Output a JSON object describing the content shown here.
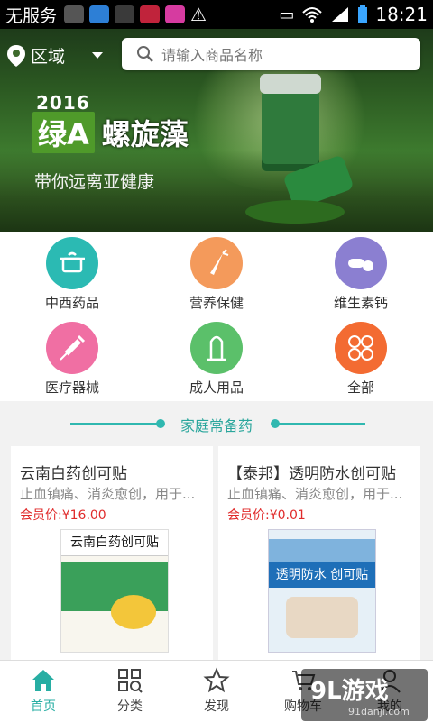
{
  "status_bar": {
    "carrier": "无服务",
    "time": "18:21"
  },
  "header": {
    "region_label": "区域",
    "search_placeholder": "请输入商品名称"
  },
  "banner": {
    "year": "2016",
    "brand_prefix": "绿A",
    "brand_name": "螺旋藻",
    "slogan": "带你远离亚健康"
  },
  "categories": [
    {
      "label": "中西药品",
      "color": "#2bbab3",
      "icon": "pot-icon"
    },
    {
      "label": "营养保健",
      "color": "#f49a5b",
      "icon": "carrot-icon"
    },
    {
      "label": "维生素钙",
      "color": "#8b7fd1",
      "icon": "pills-icon"
    },
    {
      "label": "医疗器械",
      "color": "#f06fa3",
      "icon": "syringe-icon"
    },
    {
      "label": "成人用品",
      "color": "#5bc06a",
      "icon": "condom-icon"
    },
    {
      "label": "全部",
      "color": "#f36b32",
      "icon": "all-circles-icon"
    }
  ],
  "section": {
    "title": "家庭常备药"
  },
  "products": [
    {
      "name": "云南白药创可贴",
      "desc": "止血镇痛、消炎愈创，用于...",
      "price": "会员价:¥16.00"
    },
    {
      "name": "【泰邦】透明防水创可贴",
      "desc": "止血镇痛、消炎愈创，用于...",
      "price": "会员价:¥0.01"
    }
  ],
  "product_images": [
    {
      "text": "云南白药创可贴"
    },
    {
      "text": "透明防水 创可贴"
    }
  ],
  "bottom_nav": [
    {
      "label": "首页"
    },
    {
      "label": "分类"
    },
    {
      "label": "发现"
    },
    {
      "label": "购物车"
    },
    {
      "label": "我的"
    }
  ],
  "watermark": {
    "big": "9L游戏",
    "small": "91danji.com"
  },
  "colors": {
    "accent": "#2aa69c",
    "price": "#e02b2b"
  }
}
